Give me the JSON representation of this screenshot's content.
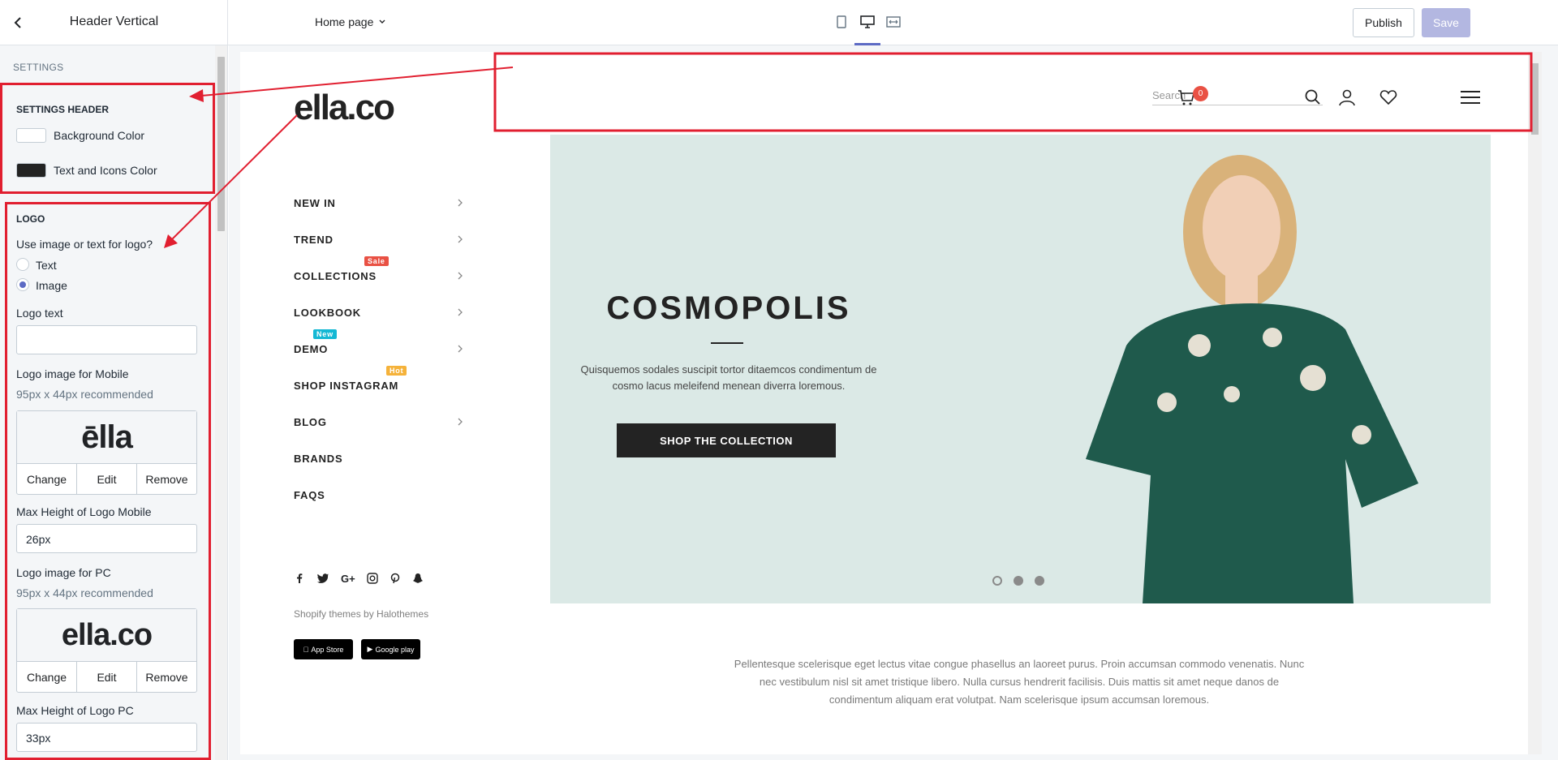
{
  "topbar": {
    "title": "Header Vertical",
    "page_select": "Home page",
    "publish": "Publish",
    "save": "Save"
  },
  "sidebar": {
    "settings_label": "SETTINGS",
    "header_section": {
      "title": "SETTINGS HEADER",
      "bg_color_label": "Background Color",
      "bg_color": "#ffffff",
      "text_color_label": "Text and Icons Color",
      "text_color": "#232323"
    },
    "logo_section": {
      "title": "LOGO",
      "question": "Use image or text for logo?",
      "opt_text": "Text",
      "opt_image": "Image",
      "logo_text_label": "Logo text",
      "logo_text_value": "",
      "mobile_label": "Logo image for Mobile",
      "mobile_hint": "95px x 44px recommended",
      "mobile_preview": "ēlla",
      "change": "Change",
      "edit": "Edit",
      "remove": "Remove",
      "max_mobile_label": "Max Height of Logo Mobile",
      "max_mobile_value": "26px",
      "pc_label": "Logo image for PC",
      "pc_hint": "95px x 44px recommended",
      "pc_preview": "ella.co",
      "max_pc_label": "Max Height of Logo PC",
      "max_pc_value": "33px"
    }
  },
  "site": {
    "logo": "ella.co",
    "search_placeholder": "Search",
    "cart_count": "0",
    "menu": [
      {
        "label": "NEW IN",
        "badge": "",
        "arrow": true
      },
      {
        "label": "TREND",
        "badge": "",
        "arrow": true
      },
      {
        "label": "COLLECTIONS",
        "badge": "Sale",
        "arrow": true
      },
      {
        "label": "LOOKBOOK",
        "badge": "",
        "arrow": true
      },
      {
        "label": "DEMO",
        "badge": "New",
        "arrow": true
      },
      {
        "label": "SHOP INSTAGRAM",
        "badge": "Hot",
        "arrow": false
      },
      {
        "label": "BLOG",
        "badge": "",
        "arrow": true
      },
      {
        "label": "BRANDS",
        "badge": "",
        "arrow": false
      },
      {
        "label": "FAQS",
        "badge": "",
        "arrow": false
      }
    ],
    "credits": "Shopify themes by Halothemes",
    "app_store": "App Store",
    "google_play": "Google play",
    "hero": {
      "title": "COSMOPOLIS",
      "text": "Quisquemos sodales suscipit tortor ditaemcos condimentum de cosmo lacus meleifend menean diverra loremous.",
      "button": "SHOP THE COLLECTION"
    },
    "paragraph": "Pellentesque scelerisque eget lectus vitae congue phasellus an laoreet purus. Proin accumsan commodo venenatis. Nunc nec vestibulum nisl sit amet tristique libero. Nulla cursus hendrerit facilisis. Duis mattis sit amet neque danos de condimentum aliquam erat volutpat. Nam scelerisque ipsum accumsan loremous."
  }
}
